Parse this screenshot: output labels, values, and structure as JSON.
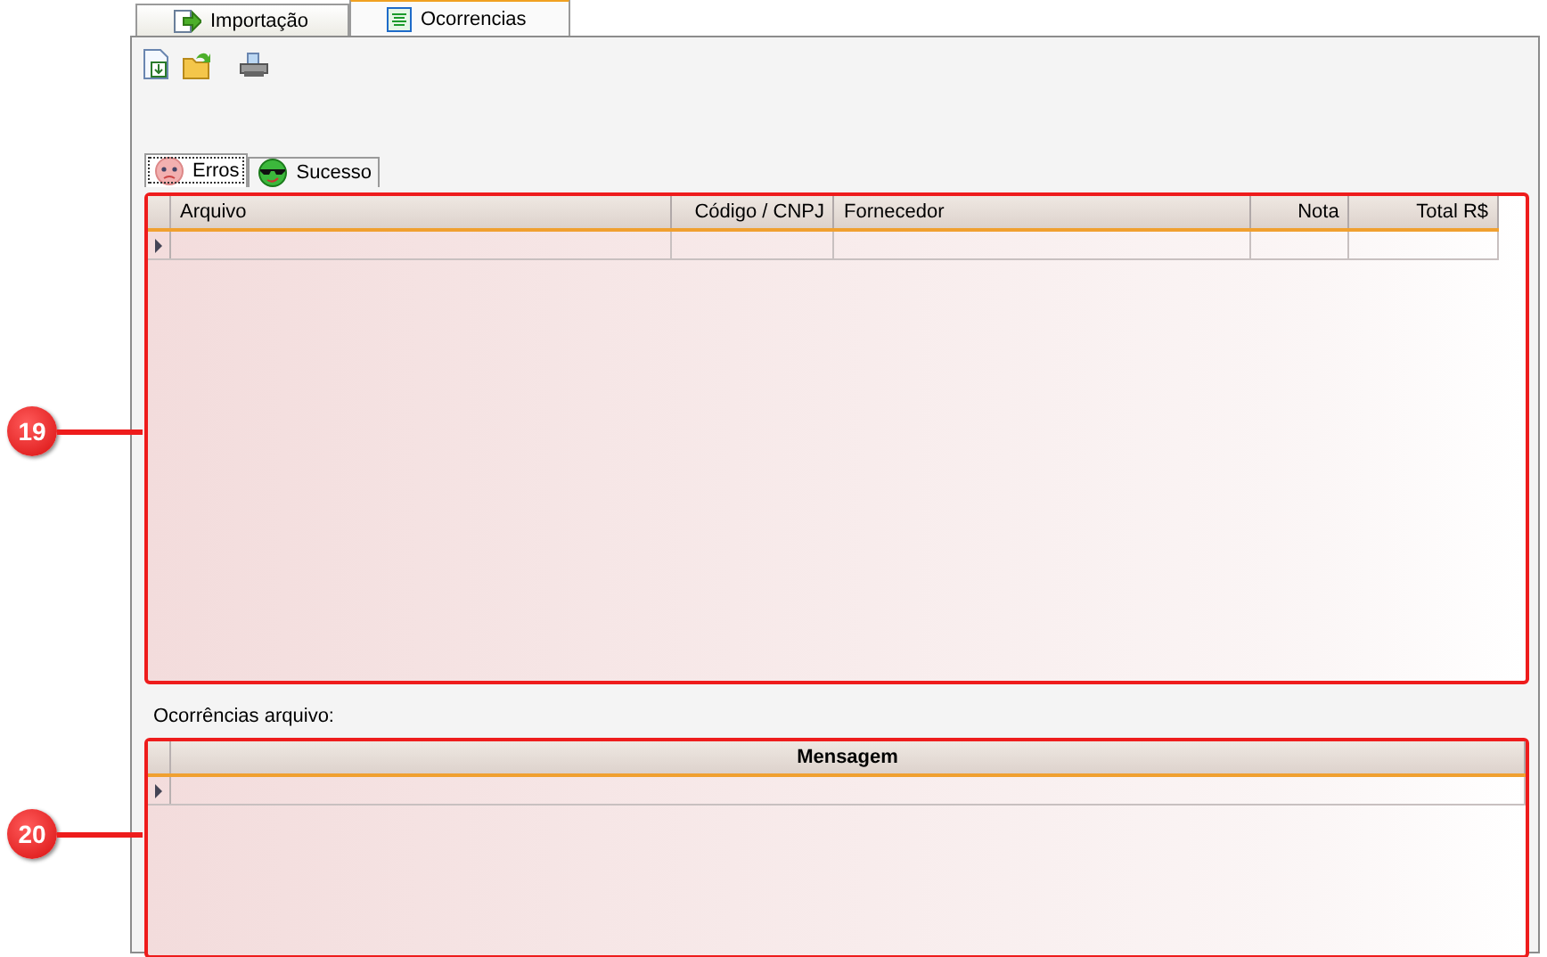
{
  "tabs": [
    {
      "label": "Importação",
      "selected": false
    },
    {
      "label": "Ocorrencias",
      "selected": true
    }
  ],
  "toolbar": [
    {
      "kind": "new"
    },
    {
      "kind": "open"
    },
    {
      "kind": "print"
    }
  ],
  "subtabs": [
    {
      "label": "Erros",
      "kind": "sad",
      "selected": true
    },
    {
      "label": "Sucesso",
      "kind": "cool",
      "selected": false
    }
  ],
  "files_grid": {
    "callout": "19",
    "columns": [
      "Arquivo",
      "Código / CNPJ",
      "Fornecedor",
      "Nota",
      "Total R$"
    ]
  },
  "messages_label": "Ocorrências arquivo:",
  "messages_grid": {
    "callout": "20",
    "columns": [
      "Mensagem"
    ]
  }
}
